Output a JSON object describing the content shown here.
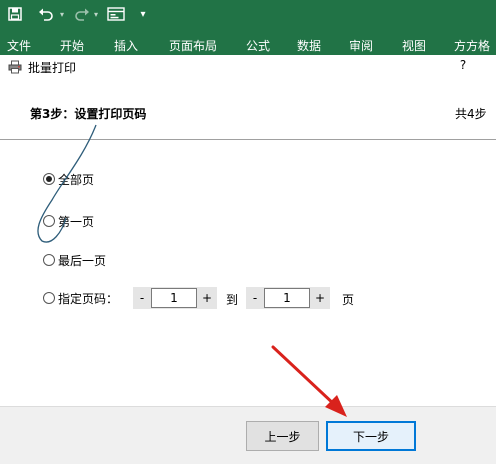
{
  "ribbon": {
    "tabs": [
      "文件",
      "开始",
      "插入",
      "页面布局",
      "公式",
      "数据",
      "审阅",
      "视图",
      "方方格"
    ]
  },
  "dialog": {
    "title": "批量打印",
    "help": "?",
    "step_title": "第3步：设置打印页码",
    "step_count": "共4步",
    "options": {
      "all": "全部页",
      "first": "第一页",
      "last": "最后一页",
      "range": "指定页码："
    },
    "selected_option": "all",
    "range": {
      "from_value": "1",
      "to_label": "到",
      "to_value": "1",
      "page_label": "页",
      "minus": "-",
      "plus": "+"
    },
    "buttons": {
      "prev": "上一步",
      "next": "下一步"
    }
  },
  "colors": {
    "ribbon": "#217346",
    "arrow": "#d9221c",
    "accent": "#0078d7"
  }
}
